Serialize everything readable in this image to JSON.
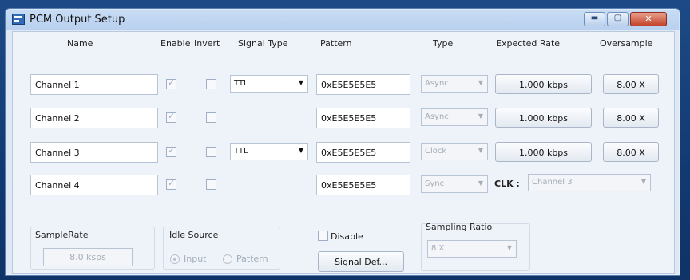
{
  "window": {
    "title": "PCM Output Setup",
    "minimize": "▬",
    "maximize": "▢",
    "close": "✕"
  },
  "headers": {
    "name": "Name",
    "enable": "Enable",
    "invert": "Invert",
    "signal_type": "Signal Type",
    "pattern": "Pattern",
    "type": "Type",
    "expected_rate": "Expected Rate",
    "oversample": "Oversample"
  },
  "channels": [
    {
      "name": "Channel 1",
      "signal_type": "TTL",
      "pattern": "0xE5E5E5E5",
      "type": "Async",
      "expected_rate": "1.000 kbps",
      "oversample": "8.00 X"
    },
    {
      "name": "Channel 2",
      "pattern": "0xE5E5E5E5",
      "type": "Async",
      "expected_rate": "1.000 kbps",
      "oversample": "8.00 X"
    },
    {
      "name": "Channel 3",
      "signal_type": "TTL",
      "pattern": "0xE5E5E5E5",
      "type": "Clock",
      "expected_rate": "1.000 kbps",
      "oversample": "8.00 X"
    },
    {
      "name": "Channel 4",
      "pattern": "0xE5E5E5E5",
      "type": "Sync",
      "clk_label": "CLK :",
      "clk_value": "Channel 3"
    }
  ],
  "bottom": {
    "samplerate_label": "SampleRate",
    "samplerate_value": "8.0 ksps",
    "idle_source_label_prefix": "I",
    "idle_source_label_rest": "dle Source",
    "idle_input": "Input",
    "idle_pattern": "Pattern",
    "disable_label": "Disable",
    "signal_def_prefix": "Signal ",
    "signal_def_u": "D",
    "signal_def_rest": "ef...",
    "sampling_ratio_label": "Sampling Ratio",
    "sampling_ratio_value": "8 X"
  },
  "icons": {
    "dropdown_arrow": "▼"
  }
}
